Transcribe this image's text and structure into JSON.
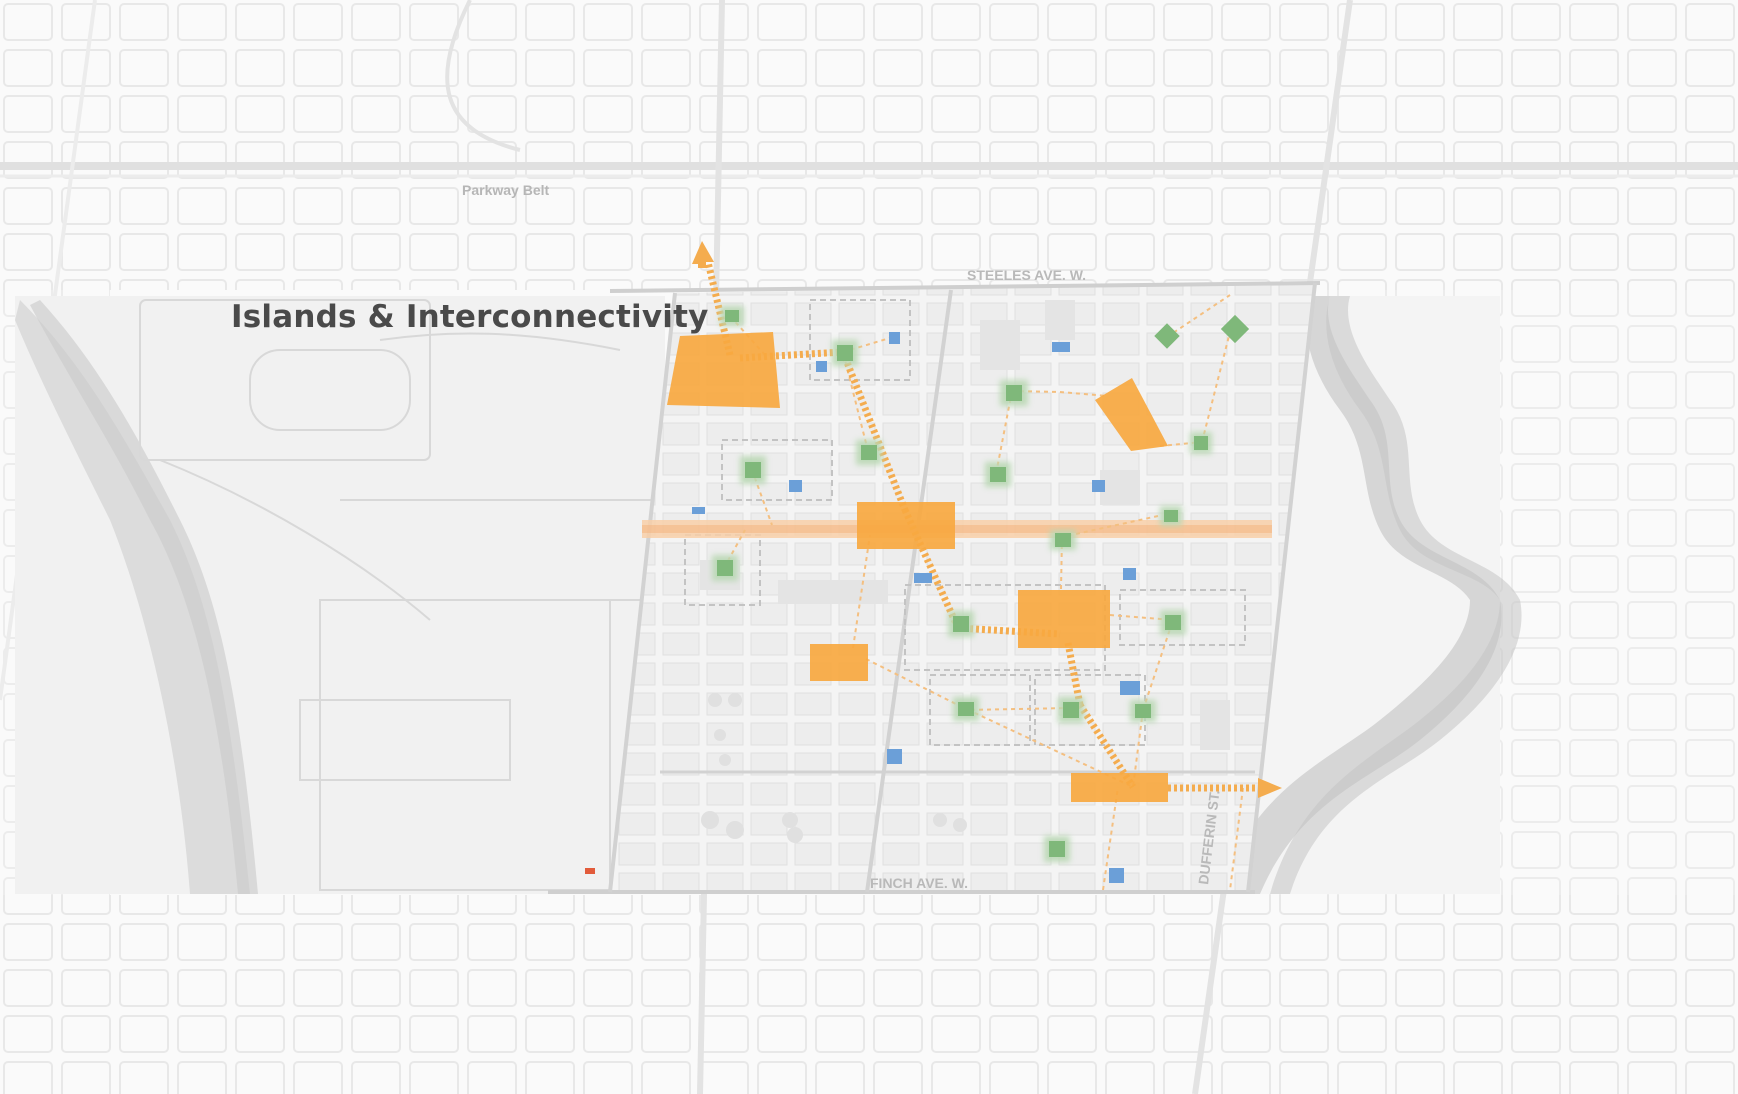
{
  "title": "Islands & Interconnectivity",
  "labels": {
    "parkway_belt": "Parkway Belt",
    "steeles": "STEELES AVE. W.",
    "finch": "FINCH AVE. W.",
    "dufferin": "DUFFERIN ST."
  },
  "legend_colors": {
    "hub": "#f7a840",
    "park": "#7fb87a",
    "facility": "#6b9fd8",
    "connector": "#f7b866"
  },
  "symbols": [
    "orange-hub",
    "green-park",
    "blue-facility",
    "dashed-connector",
    "arrow-connector"
  ]
}
